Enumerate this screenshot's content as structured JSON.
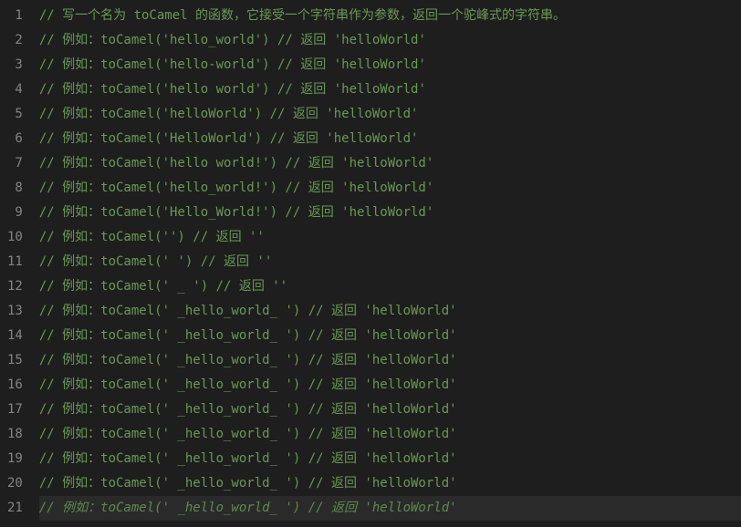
{
  "lines": [
    {
      "num": "1",
      "text": "// 写一个名为 toCamel 的函数，它接受一个字符串作为参数，返回一个驼峰式的字符串。",
      "italic": false,
      "highlighted": false
    },
    {
      "num": "2",
      "text": "// 例如：toCamel('hello_world') // 返回 'helloWorld'",
      "italic": false,
      "highlighted": false
    },
    {
      "num": "3",
      "text": "// 例如：toCamel('hello-world') // 返回 'helloWorld'",
      "italic": false,
      "highlighted": false
    },
    {
      "num": "4",
      "text": "// 例如：toCamel('hello world') // 返回 'helloWorld'",
      "italic": false,
      "highlighted": false
    },
    {
      "num": "5",
      "text": "// 例如：toCamel('helloWorld') // 返回 'helloWorld'",
      "italic": false,
      "highlighted": false
    },
    {
      "num": "6",
      "text": "// 例如：toCamel('HelloWorld') // 返回 'helloWorld'",
      "italic": false,
      "highlighted": false
    },
    {
      "num": "7",
      "text": "// 例如：toCamel('hello world!') // 返回 'helloWorld'",
      "italic": false,
      "highlighted": false
    },
    {
      "num": "8",
      "text": "// 例如：toCamel('hello_world!') // 返回 'helloWorld'",
      "italic": false,
      "highlighted": false
    },
    {
      "num": "9",
      "text": "// 例如：toCamel('Hello_World!') // 返回 'helloWorld'",
      "italic": false,
      "highlighted": false
    },
    {
      "num": "10",
      "text": "// 例如：toCamel('') // 返回 ''",
      "italic": false,
      "highlighted": false
    },
    {
      "num": "11",
      "text": "// 例如：toCamel(' ') // 返回 ''",
      "italic": false,
      "highlighted": false
    },
    {
      "num": "12",
      "text": "// 例如：toCamel(' _ ') // 返回 ''",
      "italic": false,
      "highlighted": false
    },
    {
      "num": "13",
      "text": "// 例如：toCamel(' _hello_world_ ') // 返回 'helloWorld'",
      "italic": false,
      "highlighted": false
    },
    {
      "num": "14",
      "text": "// 例如：toCamel(' _hello_world_ ') // 返回 'helloWorld'",
      "italic": false,
      "highlighted": false
    },
    {
      "num": "15",
      "text": "// 例如：toCamel(' _hello_world_ ') // 返回 'helloWorld'",
      "italic": false,
      "highlighted": false
    },
    {
      "num": "16",
      "text": "// 例如：toCamel(' _hello_world_ ') // 返回 'helloWorld'",
      "italic": false,
      "highlighted": false
    },
    {
      "num": "17",
      "text": "// 例如：toCamel(' _hello_world_ ') // 返回 'helloWorld'",
      "italic": false,
      "highlighted": false
    },
    {
      "num": "18",
      "text": "// 例如：toCamel(' _hello_world_ ') // 返回 'helloWorld'",
      "italic": false,
      "highlighted": false
    },
    {
      "num": "19",
      "text": "// 例如：toCamel(' _hello_world_ ') // 返回 'helloWorld'",
      "italic": false,
      "highlighted": false
    },
    {
      "num": "20",
      "text": "// 例如：toCamel(' _hello_world_ ') // 返回 'helloWorld'",
      "italic": false,
      "highlighted": false
    },
    {
      "num": "21",
      "text": "// 例如：toCamel(' _hello_world_ ') // 返回 'helloWorld'",
      "italic": true,
      "highlighted": true
    }
  ]
}
